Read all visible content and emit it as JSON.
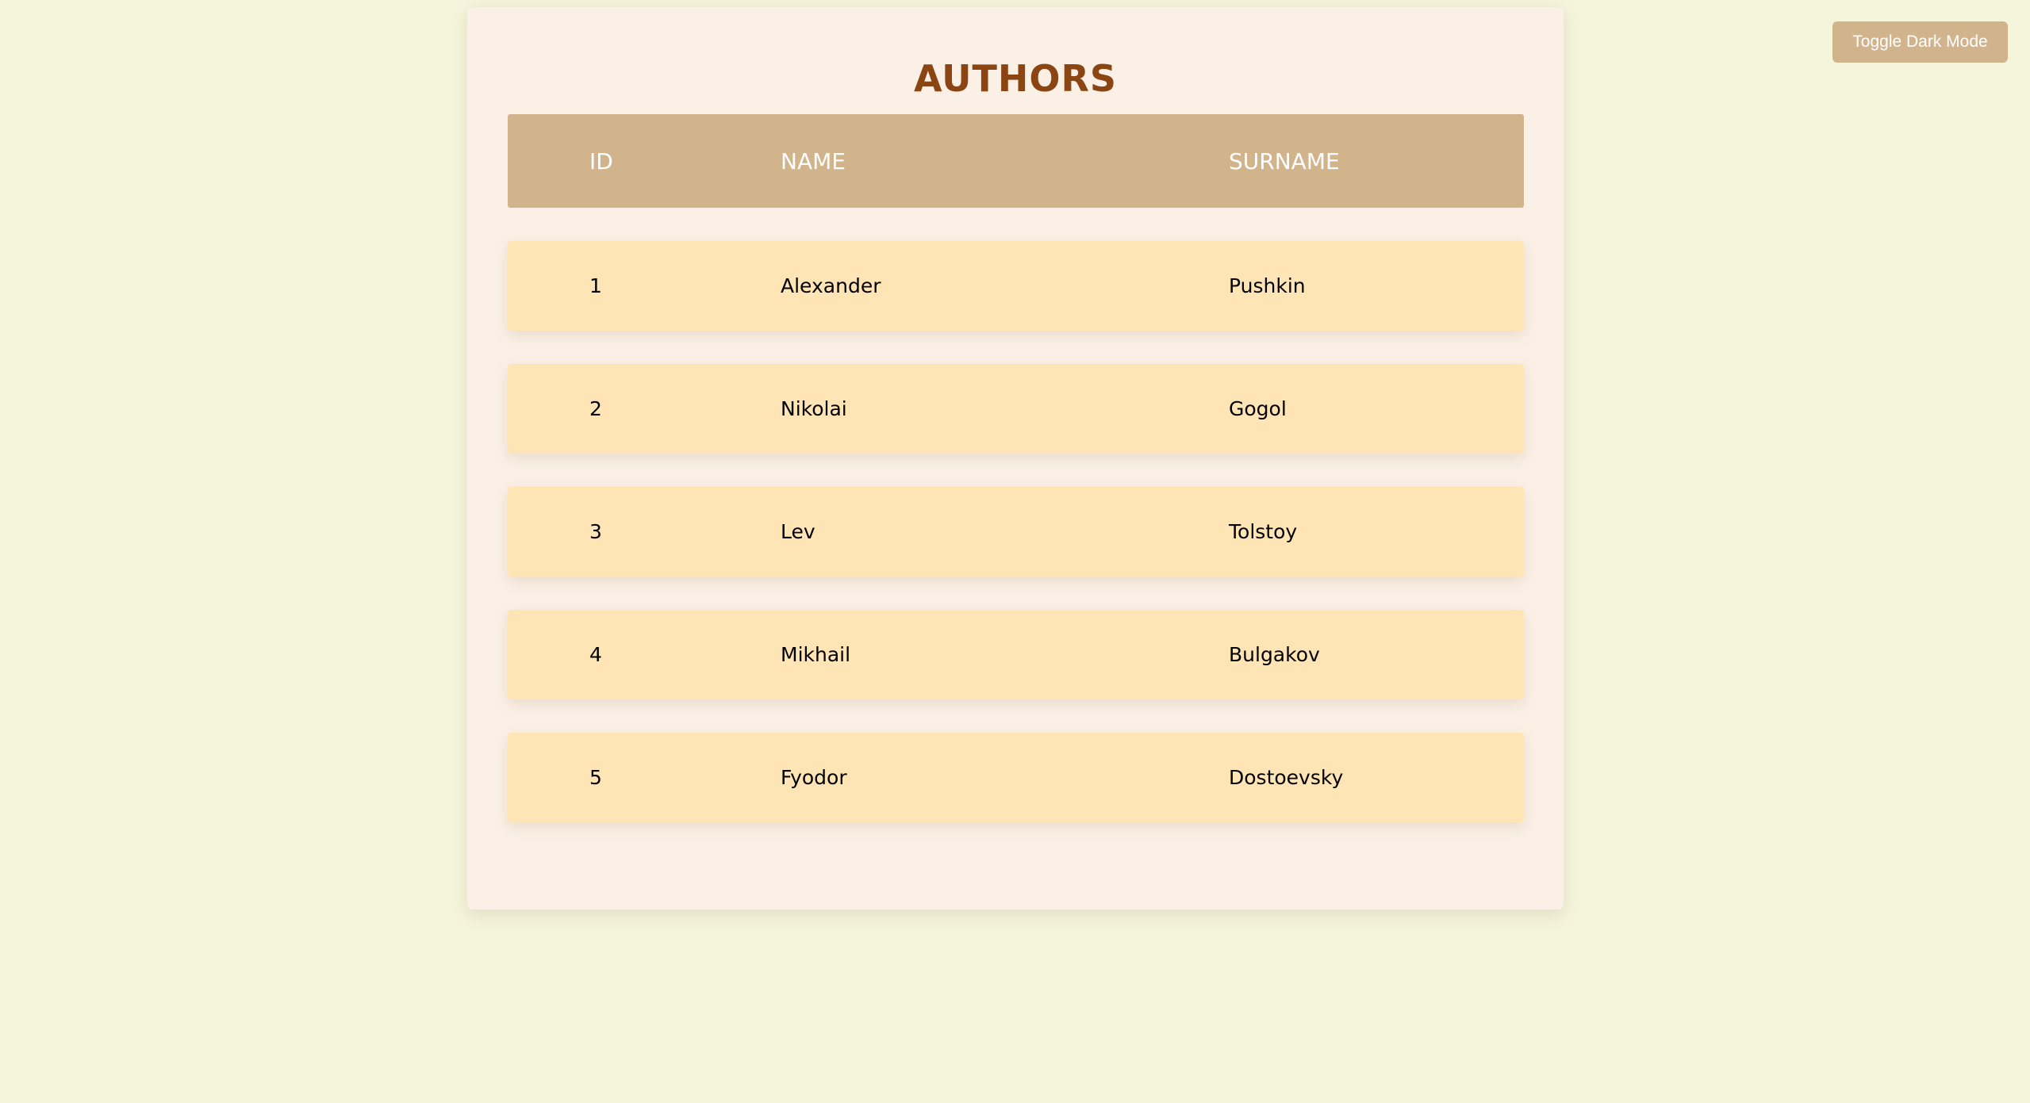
{
  "toggle_button": {
    "label": "Toggle Dark Mode"
  },
  "page": {
    "title": "AUTHORS"
  },
  "table": {
    "headers": [
      "ID",
      "NAME",
      "SURNAME"
    ],
    "rows": [
      {
        "id": "1",
        "name": "Alexander",
        "surname": "Pushkin"
      },
      {
        "id": "2",
        "name": "Nikolai",
        "surname": "Gogol"
      },
      {
        "id": "3",
        "name": "Lev",
        "surname": "Tolstoy"
      },
      {
        "id": "4",
        "name": "Mikhail",
        "surname": "Bulgakov"
      },
      {
        "id": "5",
        "name": "Fyodor",
        "surname": "Dostoevsky"
      }
    ]
  },
  "colors": {
    "page_background": "#f5f5dc",
    "panel_background": "#faf0e6",
    "title_color": "#8b4513",
    "header_background": "#d2b48c",
    "row_background": "#ffe4b5",
    "button_background": "#d2b48c"
  }
}
